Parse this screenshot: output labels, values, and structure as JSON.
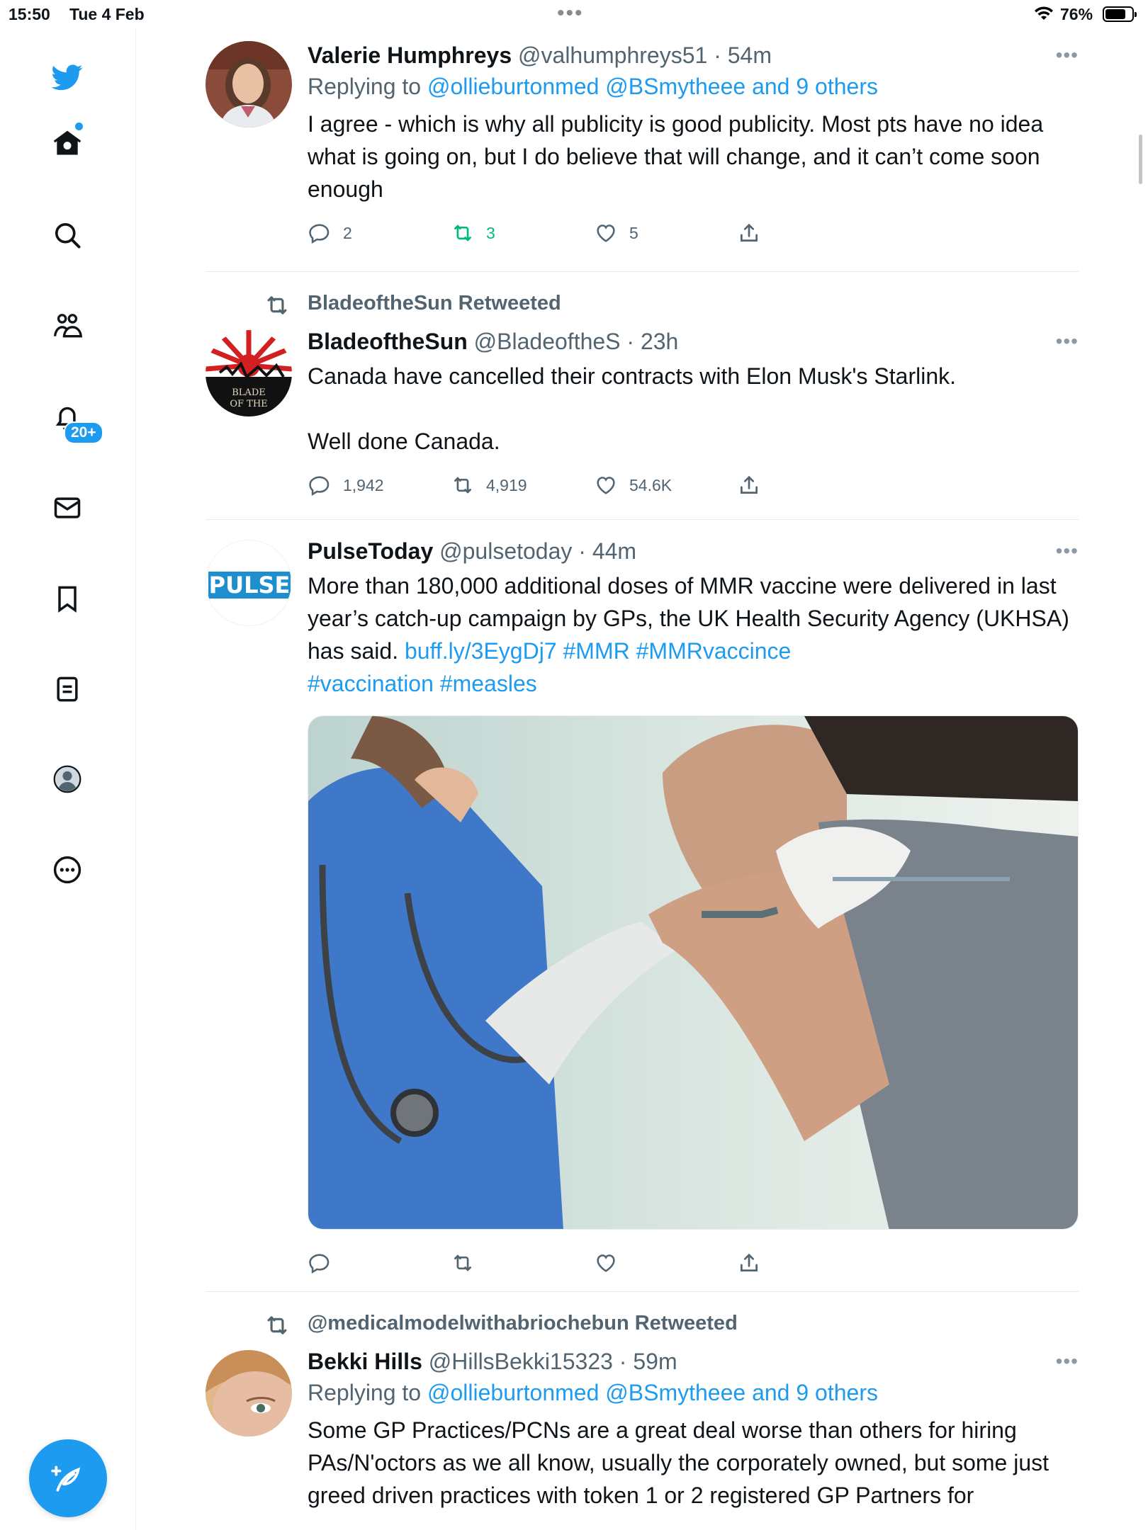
{
  "status_bar": {
    "time": "15:50",
    "date": "Tue 4 Feb",
    "battery_percent": "76%"
  },
  "sidebar": {
    "notifications_badge": "20+",
    "accent_color": "#1d9bf0",
    "items": [
      "twitter-logo-icon",
      "home-icon",
      "search-icon",
      "communities-icon",
      "notifications-icon",
      "messages-icon",
      "bookmarks-icon",
      "lists-icon",
      "profile-icon",
      "more-icon"
    ]
  },
  "tweets": [
    {
      "name": "Valerie Humphreys",
      "handle": "@valhumphreys51",
      "time": "54m",
      "meta": "@valhumphreys51 · 54m",
      "reply_prefix": "Replying to ",
      "reply_targets": "@ollieburtonmed @BSmytheee and 9 others",
      "text": "I agree - which is why all publicity is good publicity. Most pts have no idea what is going on, but I do believe that will change, and it can’t come soon enough",
      "replies": "2",
      "retweets": "3",
      "likes": "5"
    },
    {
      "retweeted_by": "BladeoftheSun Retweeted",
      "name": "BladeoftheSun",
      "handle": "@BladeoftheS",
      "time": "23h",
      "meta": "@BladeoftheS · 23h",
      "text_line1": "Canada have cancelled their contracts with Elon Musk's Starlink.",
      "text_line2": "Well done Canada.",
      "avatar_text": "BLADE OF THE",
      "replies": "1,942",
      "retweets": "4,919",
      "likes": "54.6K"
    },
    {
      "name": "PulseToday",
      "handle": "@pulsetoday",
      "time": "44m",
      "meta": "@pulsetoday · 44m",
      "avatar_text": "PULSE",
      "text": "More than 180,000 additional doses of MMR vaccine were delivered in last year’s catch-up campaign by GPs, the UK Health Security Agency (UKHSA) has said. ",
      "link": "buff.ly/3EygDj7",
      "hashtags1": " #MMR #MMRvaccince",
      "hashtags2": "#vaccination #measles"
    },
    {
      "retweeted_by": "@medicalmodelwithabriochebun Retweeted",
      "name": "Bekki Hills",
      "handle": "@HillsBekki15323",
      "time": "59m",
      "meta": "@HillsBekki15323 · 59m",
      "reply_prefix": "Replying to ",
      "reply_targets": "@ollieburtonmed @BSmytheee and 9 others",
      "text": "Some GP Practices/PCNs are a great deal worse than others for hiring PAs/N'octors as we all know, usually the corporately owned, but some just greed driven practices with token 1 or 2 registered GP Partners for"
    }
  ]
}
